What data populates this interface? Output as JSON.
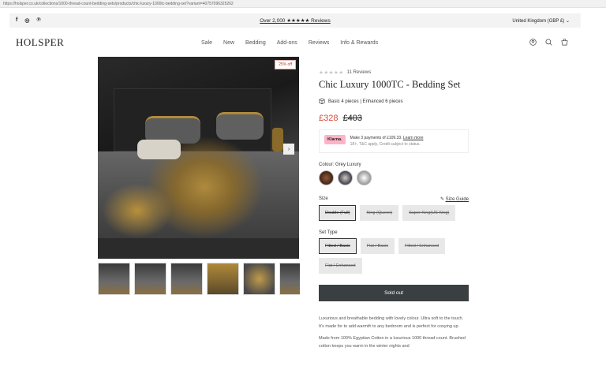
{
  "browser": {
    "url": "https://holsper.co.uk/collections/1000-thread-count-bedding-sets/products/chic-luxury-1000tc-bedding-set?variant=40757096325262"
  },
  "announcement": {
    "text": "Over 2,000 ★★★★★ Reviews",
    "locale": "United Kingdom (GBP £) ⌄",
    "social": [
      "f",
      "◎",
      "℗"
    ]
  },
  "header": {
    "logo": "HOLSPER",
    "nav": [
      "Sale",
      "New",
      "Bedding",
      "Add-ons",
      "Reviews",
      "Info & Rewards"
    ]
  },
  "gallery": {
    "badge": "25% off",
    "next_arrow": "›"
  },
  "product": {
    "stars": "★★★★★",
    "reviews": "11 Reviews",
    "title": "Chic Luxury 1000TC - Bedding Set",
    "pieces": "Basic 4 pieces | Enhanced 6 pieces",
    "price": "£328",
    "compare_price": "£403",
    "klarna": {
      "logo": "Klarna.",
      "text": "Make 3 payments of £109.33.",
      "link": "Learn more",
      "sub": "18+, T&C apply, Credit subject to status."
    },
    "colour_label": "Colour: Grey Luxury",
    "size_label": "Size",
    "size_guide": "Size Guide",
    "sizes": [
      "Double (Full)",
      "King (Queen)",
      "Super King(US King)"
    ],
    "set_type_label": "Set Type",
    "set_types": [
      "Fitted / Basic",
      "Flat / Basic",
      "Fitted / Enhanced",
      "Flat / Enhanced"
    ],
    "sold_out": "Sold out",
    "description": [
      "Luxurious and breathable bedding with lovely colour. Ultra soft to the touch. It's made for to add warmth to any bedroom and is perfect for cosying up.",
      "Made from 100% Egyptian Cotton in a luxurious 1000 thread count. Brushed cotton keeps you warm in the winter nights and"
    ]
  },
  "colors": {
    "price": "#d8493a",
    "button": "#3a3f41",
    "klarna": "#ffb3c7"
  }
}
